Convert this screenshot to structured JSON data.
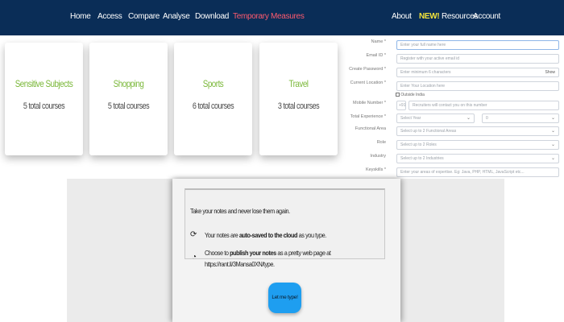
{
  "nav": {
    "home": "Home",
    "access": "Access",
    "compare": "Compare",
    "analyse": "Analyse",
    "download": "Download",
    "temporary": "Temporary Measures",
    "about": "About",
    "new_badge": "NEW!",
    "resources": "Resources",
    "account": "Account"
  },
  "cards": [
    {
      "title": "Sensitive Subjects",
      "count": "5 total courses"
    },
    {
      "title": "Shopping",
      "count": "5 total courses"
    },
    {
      "title": "Sports",
      "count": "6 total courses"
    },
    {
      "title": "Travel",
      "count": "3 total courses"
    }
  ],
  "form": {
    "name_label": "Name *",
    "name_placeholder": "Enter your full name here",
    "email_label": "Email ID *",
    "email_placeholder": "Register with your active email id",
    "password_label": "Create Password *",
    "password_placeholder": "Enter minimum 6 characters",
    "show": "Show",
    "location_label": "Current Location *",
    "location_placeholder": "Enter Your Location here",
    "outside_india": "Outside India",
    "mobile_label": "Mobile Number *",
    "country_code": "+91",
    "mobile_placeholder": "Recruiters will contact you on this number",
    "experience_label": "Total Experience *",
    "experience_year": "Select Year",
    "experience_month": "0",
    "functional_label": "Functional Area",
    "functional_placeholder": "Select up to 2 Functional Areas",
    "role_label": "Role",
    "role_placeholder": "Select up to 2 Roles",
    "industry_label": "Industry",
    "industry_placeholder": "Select up to 2 Industries",
    "keyskills_label": "Keyskills *",
    "keyskills_placeholder": "Enter your areas of expertise. Eg: Java, PHP, HTML, JavaScript etc..."
  },
  "notes": {
    "intro": "Take your notes and never lose them again.",
    "line1_a": "Your notes are ",
    "line1_b": "auto-saved to the cloud",
    "line1_c": " as you type.",
    "line2_a": "Choose to ",
    "line2_b": "publish your notes",
    "line2_c": " as a pretty web page at",
    "line2_url": "https://rant.li/3Mansa0XN/type.",
    "button": "Let me type!"
  }
}
